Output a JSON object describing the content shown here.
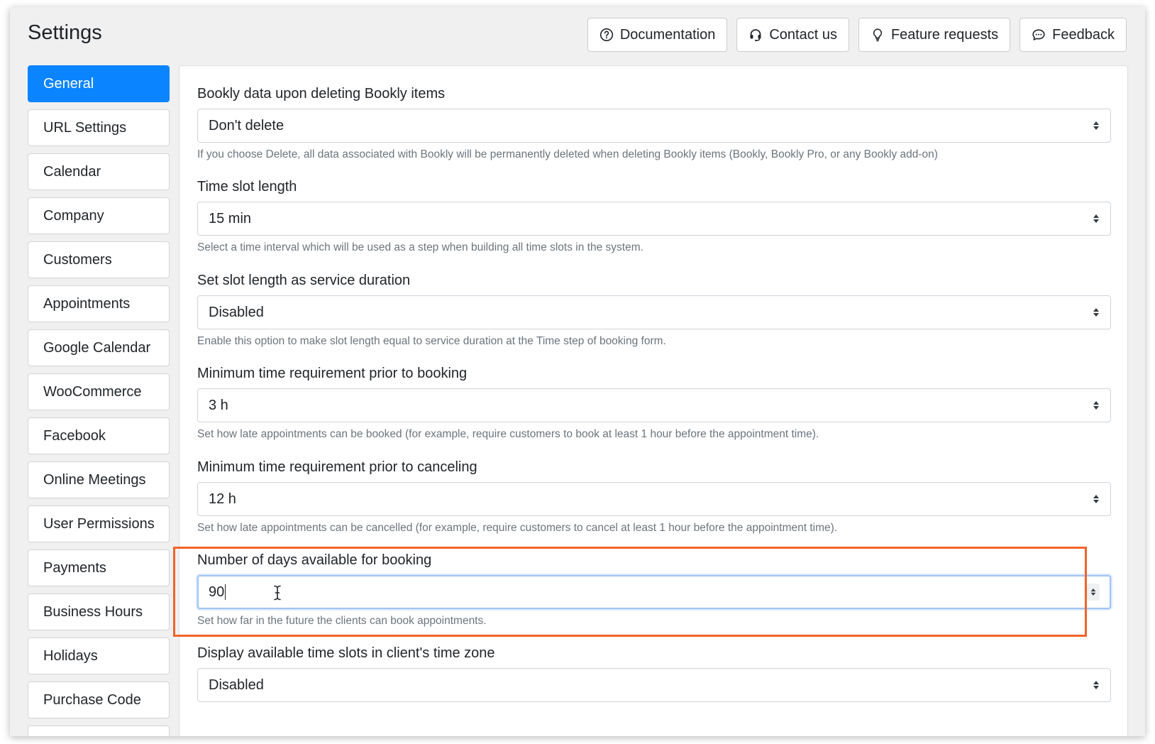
{
  "header": {
    "title": "Settings",
    "buttons": [
      {
        "label": "Documentation",
        "icon": "question-circle-icon"
      },
      {
        "label": "Contact us",
        "icon": "headset-icon"
      },
      {
        "label": "Feature requests",
        "icon": "lightbulb-icon"
      },
      {
        "label": "Feedback",
        "icon": "chat-icon"
      }
    ]
  },
  "sidebar": {
    "active": "General",
    "items": [
      {
        "label": "General"
      },
      {
        "label": "URL Settings"
      },
      {
        "label": "Calendar"
      },
      {
        "label": "Company"
      },
      {
        "label": "Customers"
      },
      {
        "label": "Appointments"
      },
      {
        "label": "Google Calendar"
      },
      {
        "label": "WooCommerce"
      },
      {
        "label": "Facebook"
      },
      {
        "label": "Online Meetings"
      },
      {
        "label": "User Permissions"
      },
      {
        "label": "Payments"
      },
      {
        "label": "Business Hours"
      },
      {
        "label": "Holidays"
      },
      {
        "label": "Purchase Code"
      }
    ]
  },
  "fields": [
    {
      "label": "Bookly data upon deleting Bookly items",
      "value": "Don't delete",
      "help": "If you choose Delete, all data associated with Bookly will be permanently deleted when deleting Bookly items (Bookly, Bookly Pro, or any Bookly add-on)"
    },
    {
      "label": "Time slot length",
      "value": "15 min",
      "help": "Select a time interval which will be used as a step when building all time slots in the system."
    },
    {
      "label": "Set slot length as service duration",
      "value": "Disabled",
      "help": "Enable this option to make slot length equal to service duration at the Time step of booking form."
    },
    {
      "label": "Minimum time requirement prior to booking",
      "value": "3 h",
      "help": "Set how late appointments can be booked (for example, require customers to book at least 1 hour before the appointment time)."
    },
    {
      "label": "Minimum time requirement prior to canceling",
      "value": "12 h",
      "help": "Set how late appointments can be cancelled (for example, require customers to cancel at least 1 hour before the appointment time)."
    },
    {
      "label": "Number of days available for booking",
      "value": "90",
      "help": "Set how far in the future the clients can book appointments."
    },
    {
      "label": "Display available time slots in client's time zone",
      "value": "Disabled",
      "help": ""
    }
  ],
  "colors": {
    "accent": "#0a84ff",
    "highlight": "#f0642a"
  }
}
